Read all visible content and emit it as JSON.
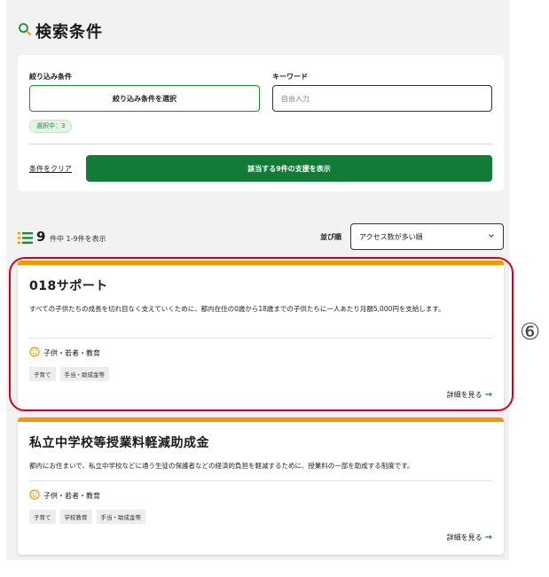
{
  "search": {
    "title": "検索条件",
    "filter_label": "絞り込み条件",
    "filter_button": "絞り込み条件を選択",
    "selected_chip": "選択中：3",
    "keyword_label": "キーワード",
    "keyword_placeholder": "自由入力",
    "clear_link": "条件をクリア",
    "show_button": "該当する9件の支援を表示"
  },
  "results": {
    "count": "9",
    "count_text": "件中 1-9件を表示",
    "sort_label": "並び順",
    "sort_value": "アクセス数が多い順"
  },
  "cards": [
    {
      "title": "018サポート",
      "description": "すべての子供たちの成長を切れ目なく支えていくために、都内在住の0歳から18歳までの子供たちに一人あたり月額5,000円を支給します。",
      "category": "子供・若者・教育",
      "tags": [
        "子育て",
        "手当・助成金等"
      ],
      "more": "詳細を見る"
    },
    {
      "title": "私立中学校等授業料軽減助成金",
      "description": "都内にお住まいで、私立中学校などに通う生徒の保護者などの経済的負担を軽減するために、授業料の一部を助成する制度です。",
      "category": "子供・若者・教育",
      "tags": [
        "子育て",
        "学校教育",
        "手当・助成金等"
      ],
      "more": "詳細を見る"
    }
  ],
  "annotation": "⑥",
  "colors": {
    "accent_green": "#137a37",
    "card_border": "#f39800",
    "highlight": "#d0021b"
  },
  "icons": [
    "search-icon",
    "list-icon",
    "chevron-down-icon",
    "smiley-icon",
    "arrow-right-icon"
  ]
}
